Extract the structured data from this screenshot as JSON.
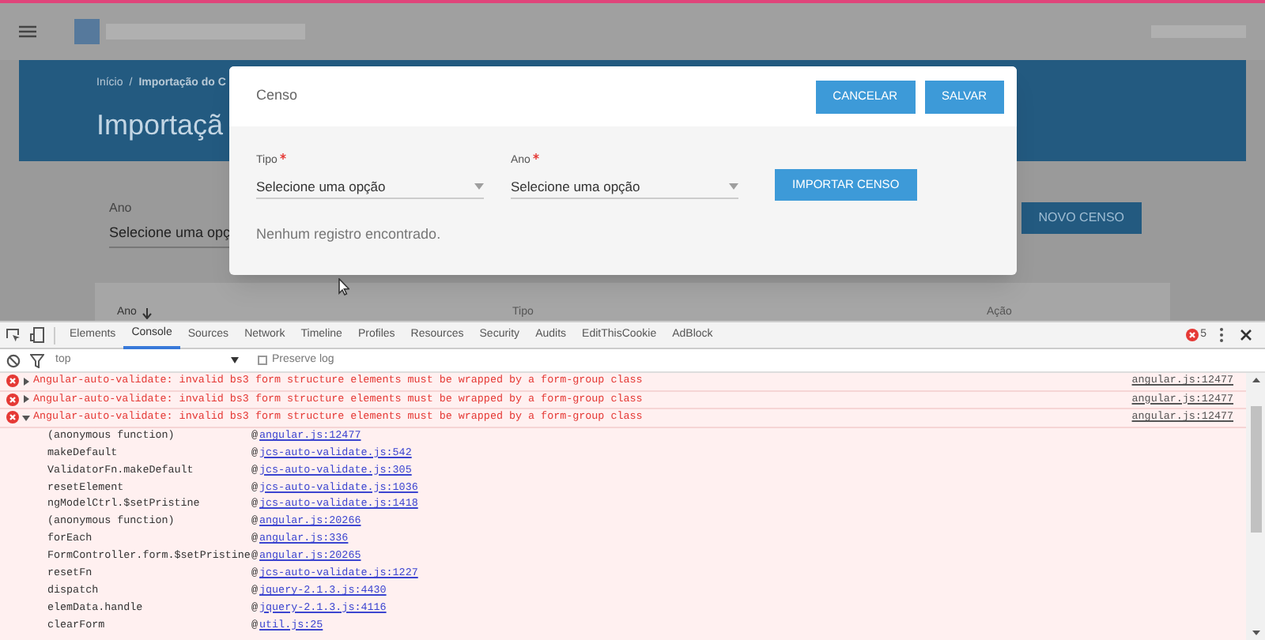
{
  "page": {
    "breadcrumb": [
      "Início",
      "/",
      "Importação do C"
    ],
    "title": "Importaçã",
    "filter": {
      "label": "Ano",
      "value": "Selecione uma opç"
    },
    "new_button": "NOVO CENSO",
    "table": {
      "columns": [
        {
          "label": "Ano",
          "sorted": true
        },
        {
          "label": "Tipo",
          "sorted": false
        },
        {
          "label": "Ação",
          "sorted": false
        }
      ]
    }
  },
  "modal": {
    "title": "Censo",
    "buttons": [
      "CANCELAR",
      "SALVAR"
    ],
    "fields": [
      {
        "label": "Tipo",
        "required": true,
        "value": "Selecione uma opção"
      },
      {
        "label": "Ano",
        "required": true,
        "value": "Selecione uma opção"
      }
    ],
    "import_button": "IMPORTAR CENSO",
    "empty_message": "Nenhum registro encontrado."
  },
  "devtools": {
    "tabs": [
      {
        "label": "Elements",
        "selected": false
      },
      {
        "label": "Console",
        "selected": true
      },
      {
        "label": "Sources",
        "selected": false
      },
      {
        "label": "Network",
        "selected": false
      },
      {
        "label": "Timeline",
        "selected": false
      },
      {
        "label": "Profiles",
        "selected": false
      },
      {
        "label": "Resources",
        "selected": false
      },
      {
        "label": "Security",
        "selected": false
      },
      {
        "label": "Audits",
        "selected": false
      },
      {
        "label": "EditThisCookie",
        "selected": false
      },
      {
        "label": "AdBlock",
        "selected": false
      }
    ],
    "error_count": "5",
    "context": "top",
    "preserve_log": {
      "label": "Preserve log",
      "checked": false
    },
    "messages": [
      {
        "text": "Angular-auto-validate: invalid bs3 form structure elements must be wrapped by a form-group class",
        "source": "angular.js:12477",
        "expanded": false
      },
      {
        "text": "Angular-auto-validate: invalid bs3 form structure elements must be wrapped by a form-group class",
        "source": "angular.js:12477",
        "expanded": false
      },
      {
        "text": "Angular-auto-validate: invalid bs3 form structure elements must be wrapped by a form-group class",
        "source": "angular.js:12477",
        "expanded": true
      }
    ],
    "stack_separator": "@",
    "stack": [
      {
        "function": "(anonymous function)",
        "source": "angular.js:12477"
      },
      {
        "function": "makeDefault",
        "source": "jcs-auto-validate.js:542"
      },
      {
        "function": "ValidatorFn.makeDefault",
        "source": "jcs-auto-validate.js:305"
      },
      {
        "function": "resetElement",
        "source": "jcs-auto-validate.js:1036"
      },
      {
        "function": "ngModelCtrl.$setPristine",
        "source": "jcs-auto-validate.js:1418"
      },
      {
        "function": "(anonymous function)",
        "source": "angular.js:20266"
      },
      {
        "function": "forEach",
        "source": "angular.js:336"
      },
      {
        "function": "FormController.form.$setPristine",
        "source": "angular.js:20265"
      },
      {
        "function": "resetFn",
        "source": "jcs-auto-validate.js:1227"
      },
      {
        "function": "dispatch",
        "source": "jquery-2.1.3.js:4430"
      },
      {
        "function": "elemData.handle",
        "source": "jquery-2.1.3.js:4116"
      },
      {
        "function": "clearForm",
        "source": "util.js:25"
      }
    ]
  }
}
